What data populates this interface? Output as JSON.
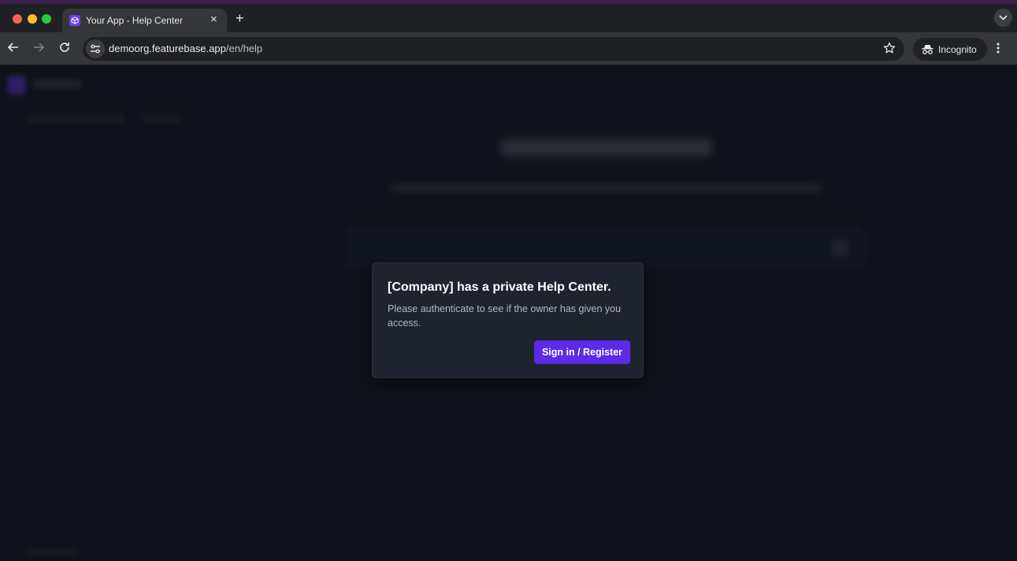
{
  "browser": {
    "tab": {
      "title": "Your App - Help Center",
      "close_icon": "close-icon",
      "favicon": "cube-icon"
    },
    "new_tab_icon": "plus-icon",
    "tabs_menu_icon": "chevron-down-icon",
    "address_bar": {
      "url_domain": "demoorg.featurebase.app",
      "url_path": "/en/help",
      "site_info_icon": "tune-icon",
      "bookmark_icon": "star-icon"
    },
    "incognito_label": "Incognito",
    "menu_icon": "kebab-icon"
  },
  "modal": {
    "title": "[Company] has a private Help Center.",
    "body": "Please authenticate to see if the owner has given you access.",
    "button_label": "Sign in / Register"
  },
  "colors": {
    "accent": "#5b2be8",
    "page_bg": "#0f121a",
    "modal_bg": "#1f232e"
  }
}
